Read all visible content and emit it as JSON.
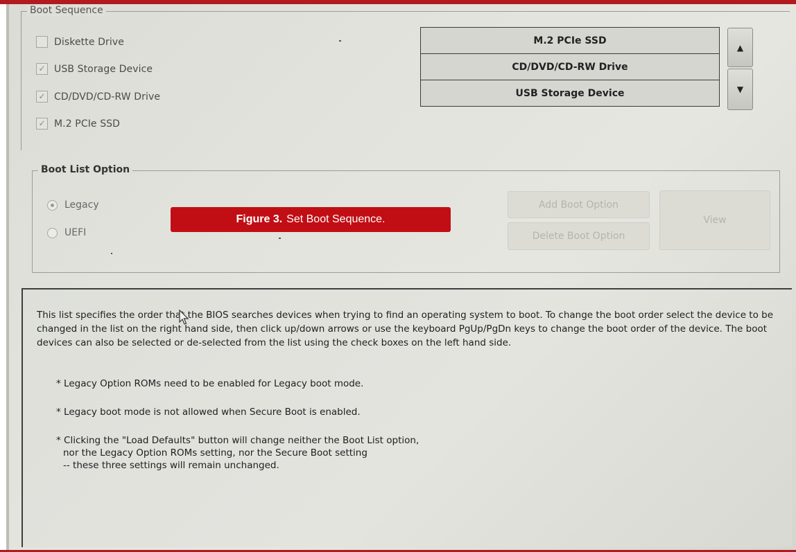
{
  "boot_sequence": {
    "legend": "Boot Sequence",
    "checkboxes": [
      {
        "label": "Diskette Drive",
        "checked": false
      },
      {
        "label": "USB Storage Device",
        "checked": true
      },
      {
        "label": "CD/DVD/CD-RW Drive",
        "checked": true
      },
      {
        "label": "M.2 PCIe SSD",
        "checked": true
      }
    ],
    "order_list": [
      "M.2 PCIe SSD",
      "CD/DVD/CD-RW Drive",
      "USB Storage Device"
    ]
  },
  "boot_list_option": {
    "legend": "Boot List Option",
    "radios": [
      {
        "label": "Legacy",
        "selected": true
      },
      {
        "label": "UEFI",
        "selected": false
      }
    ],
    "add_button": "Add Boot Option",
    "delete_button": "Delete Boot Option",
    "view_button": "View"
  },
  "description": {
    "paragraph": "This list specifies the order that the BIOS searches devices when trying to find an operating system to boot. To change the boot order select the device to be changed in the list on the right hand side, then click up/down arrows or use the keyboard PgUp/PgDn keys to change the boot order of the device. The boot devices can also be selected or de-selected from the list using the check boxes on the left hand side.",
    "notes": [
      "* Legacy Option ROMs need to be enabled for Legacy boot mode.",
      "* Legacy boot mode is not allowed when Secure Boot is enabled.",
      "* Clicking the \"Load Defaults\" button will change neither the Boot List option,",
      "nor the Legacy Option ROMs setting, nor the Secure Boot setting",
      "-- these three settings will remain unchanged."
    ]
  },
  "caption": {
    "label": "Figure 3.",
    "text": "Set Boot Sequence."
  },
  "colors": {
    "accent": "#b11a1f",
    "caption_bg": "#c10e14"
  }
}
